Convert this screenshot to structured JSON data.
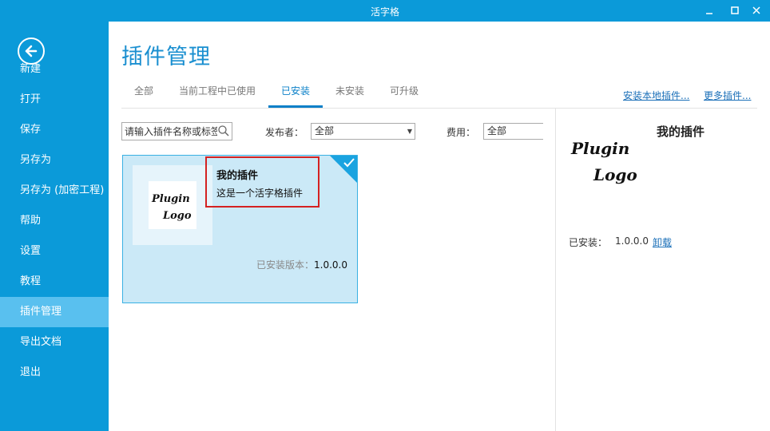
{
  "window": {
    "title": "活字格",
    "controls": [
      "minimize-icon",
      "maximize-icon",
      "close-icon"
    ]
  },
  "sidebar": {
    "back_icon": "arrow-left-icon",
    "items": [
      {
        "label": "新建"
      },
      {
        "label": "打开"
      },
      {
        "label": "保存"
      },
      {
        "label": "另存为"
      },
      {
        "label": "另存为 (加密工程)"
      },
      {
        "label": "帮助"
      },
      {
        "label": "设置"
      },
      {
        "label": "教程"
      },
      {
        "label": "插件管理",
        "active": true
      },
      {
        "label": "导出文档"
      },
      {
        "label": "退出"
      }
    ]
  },
  "main": {
    "title": "插件管理",
    "tabs": [
      {
        "label": "全部"
      },
      {
        "label": "当前工程中已使用"
      },
      {
        "label": "已安装",
        "active": true
      },
      {
        "label": "未安装"
      },
      {
        "label": "可升级"
      }
    ],
    "links": {
      "install_local": "安装本地插件...",
      "more_plugins": "更多插件..."
    },
    "filters": {
      "search_placeholder": "请输入插件名称或标签",
      "publisher_label": "发布者：",
      "publisher_value": "全部",
      "fee_label": "费用：",
      "fee_value": "全部"
    },
    "plugins": [
      {
        "name": "我的插件",
        "description": "这是一个活字格插件",
        "version_label": "已安装版本：",
        "version": "1.0.0.0",
        "logo_text": [
          "Plugin",
          "Logo"
        ],
        "selected": true
      }
    ],
    "detail": {
      "name": "我的插件",
      "logo_text": [
        "Plugin",
        "Logo"
      ],
      "installed_label": "已安装：",
      "version": "1.0.0.0",
      "uninstall_label": "卸载"
    }
  },
  "colors": {
    "brand": "#0b9ad9",
    "nav_active": "#59c0ef",
    "card_bg": "#cbe9f7",
    "highlight": "#d42121"
  }
}
